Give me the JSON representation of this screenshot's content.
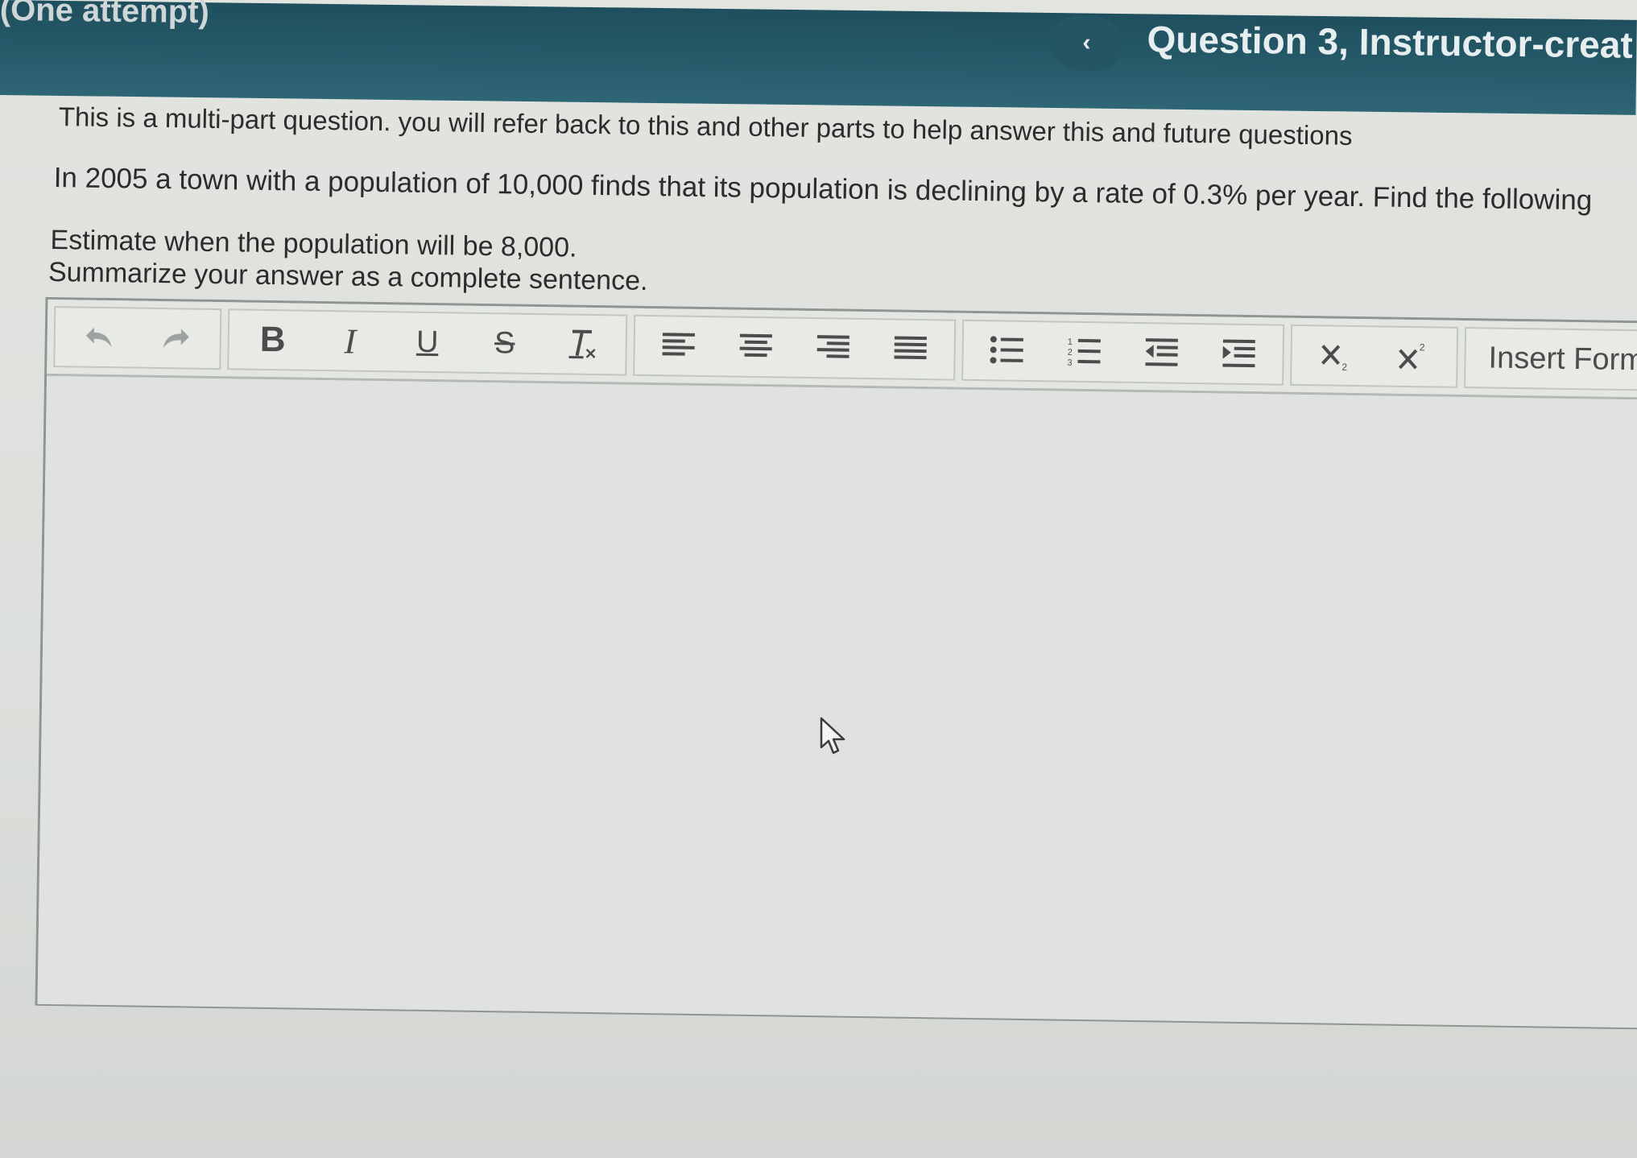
{
  "header": {
    "attempt_label": "(One attempt)",
    "back_icon": "chevron-left-icon",
    "question_title": "Question 3, Instructor-creat"
  },
  "question": {
    "intro": "This is a multi-part question. you will refer back to this and other parts to help answer this and future questions",
    "problem": "In 2005 a town with a population of 10,000 finds that its population is declining by a rate of 0.3% per year.  Find the following",
    "prompt_line1": "Estimate when the population will be 8,000.",
    "prompt_line2": "Summarize your answer as a complete sentence."
  },
  "toolbar": {
    "icons": [
      "undo-icon",
      "redo-icon",
      "bold-icon",
      "italic-icon",
      "underline-icon",
      "strikethrough-icon",
      "clear-formatting-icon",
      "align-left-icon",
      "align-center-icon",
      "align-right-icon",
      "align-justify-icon",
      "bullet-list-icon",
      "numbered-list-icon",
      "outdent-icon",
      "indent-icon",
      "subscript-icon",
      "superscript-icon"
    ],
    "bold_label": "B",
    "italic_label": "I",
    "underline_label": "U",
    "strike_label": "S",
    "insert_formula_label": "Insert Formu"
  },
  "editor": {
    "value": ""
  },
  "colors": {
    "header_bg": "#275c6b",
    "header_text": "#e6eef0",
    "page_bg": "#dcdfdb",
    "text": "#2a2d2c"
  }
}
